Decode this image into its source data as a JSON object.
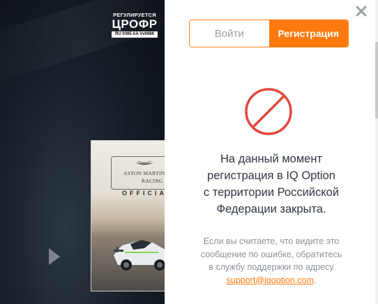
{
  "regulator": {
    "caption": "РЕГУЛИРУЕТСЯ",
    "name": "ЦРОФР",
    "license": "RU 0395 AA Vv0086"
  },
  "promo": {
    "brand_line1": "ASTON MARTIN",
    "brand_line2": "RACING",
    "official": "OFFICIA"
  },
  "tabs": {
    "login": "Войти",
    "register": "Регистрация",
    "active": "register"
  },
  "message": {
    "line1": "На данный момент",
    "line2": "регистрация в IQ Option",
    "line3": "с территории Российской",
    "line4": "Федерации закрыта."
  },
  "note": {
    "line1": "Если вы считаете, что видите это",
    "line2": "сообщение по ошибке, обратитесь",
    "line3": "в службу поддержки по адресу",
    "email": "support@iqoption.com",
    "suffix": "."
  },
  "colors": {
    "accent": "#ff7a0e",
    "block_icon": "#e0483f",
    "panel_bg": "#ffffff",
    "page_bg": "#0f141b"
  },
  "icons": {
    "close": "close-icon",
    "block": "no-entry-icon",
    "arrow": "play-arrow-icon"
  }
}
